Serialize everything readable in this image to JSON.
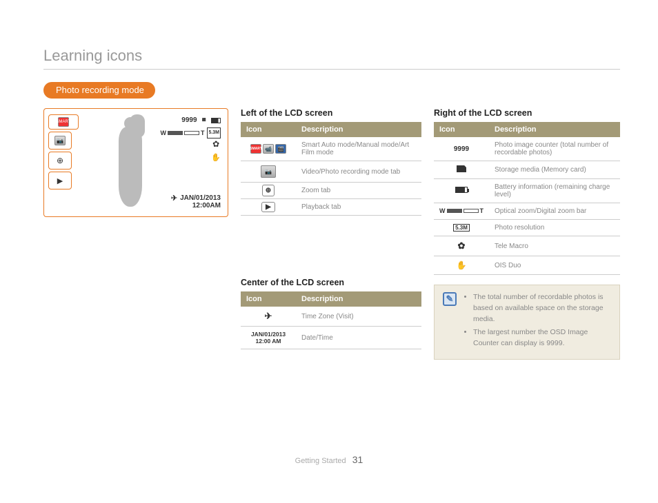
{
  "page_title": "Learning icons",
  "section_pill": "Photo recording mode",
  "lcd": {
    "counter": "9999",
    "date": "JAN/01/2013",
    "time": "12:00AM"
  },
  "left_table": {
    "title": "Left of the LCD screen",
    "header_icon": "Icon",
    "header_desc": "Description",
    "rows": [
      {
        "icon_label": "SMART",
        "desc": "Smart Auto mode/Manual mode/Art Film mode"
      },
      {
        "icon_label": "camera-icon",
        "desc": "Video/Photo recording mode tab"
      },
      {
        "icon_label": "zoom-icon",
        "desc": "Zoom tab"
      },
      {
        "icon_label": "playback-icon",
        "desc": "Playback tab"
      }
    ]
  },
  "center_table": {
    "title": "Center of the LCD screen",
    "header_icon": "Icon",
    "header_desc": "Description",
    "rows": [
      {
        "icon_label": "timezone-icon",
        "desc": "Time Zone (Visit)"
      },
      {
        "icon_label": "JAN/01/2013\n12:00 AM",
        "desc": "Date/Time"
      }
    ]
  },
  "right_table": {
    "title": "Right of the LCD screen",
    "header_icon": "Icon",
    "header_desc": "Description",
    "rows": [
      {
        "icon_label": "9999",
        "desc": "Photo image counter (total number of recordable photos)"
      },
      {
        "icon_label": "card-icon",
        "desc": "Storage media (Memory card)"
      },
      {
        "icon_label": "battery-icon",
        "desc": "Battery information (remaining charge level)"
      },
      {
        "icon_label": "zoom-bar-icon",
        "desc": "Optical zoom/Digital zoom bar"
      },
      {
        "icon_label": "resolution-icon",
        "desc": "Photo resolution"
      },
      {
        "icon_label": "macro-icon",
        "desc": "Tele Macro"
      },
      {
        "icon_label": "ois-icon",
        "desc": "OIS Duo"
      }
    ]
  },
  "note": {
    "items": [
      "The total number of recordable photos is based on available space on the storage media.",
      "The largest number the OSD Image Counter can display is 9999."
    ]
  },
  "footer": {
    "section": "Getting Started",
    "page": "31"
  }
}
